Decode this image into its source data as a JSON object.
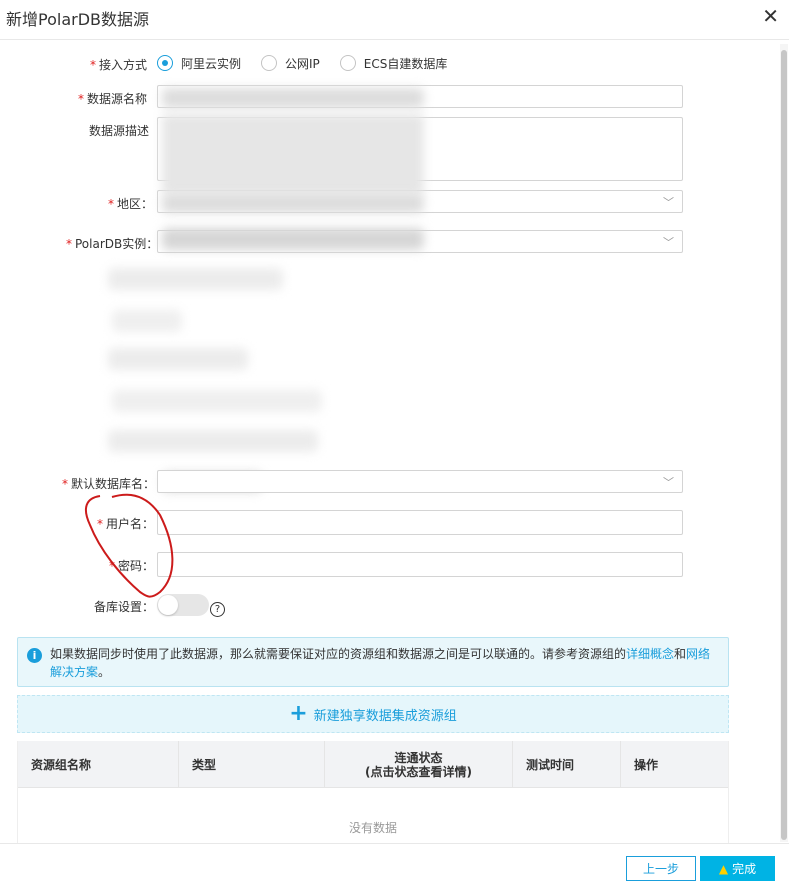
{
  "dialog": {
    "title": "新增PolarDB数据源",
    "close_icon": "close-icon"
  },
  "form": {
    "access_mode": {
      "label": "接入方式",
      "options": [
        "阿里云实例",
        "公网IP",
        "ECS自建数据库"
      ],
      "selected": "阿里云实例"
    },
    "datasource_name": {
      "label": "数据源名称"
    },
    "datasource_desc": {
      "label": "数据源描述"
    },
    "region": {
      "label": "地区"
    },
    "polardb_instance": {
      "label": "PolarDB实例"
    },
    "default_db": {
      "label": "默认数据库名"
    },
    "username": {
      "label": "用户名"
    },
    "password": {
      "label": "密码"
    },
    "standby": {
      "label": "备库设置",
      "help_icon": "question-icon"
    }
  },
  "required_mark": "*",
  "colon": "：",
  "info": {
    "text": "如果数据同步时使用了此数据源，那么就需要保证对应的资源组和数据源之间是可以联通的。请参考资源组的",
    "link1": "详细概念",
    "and": "和",
    "link2": "网络解决方案",
    "end": "。"
  },
  "new_group": {
    "label": "新建独享数据集成资源组"
  },
  "table": {
    "headers": [
      "资源组名称",
      "类型",
      "连通状态",
      "(点击状态查看详情)",
      "测试时间",
      "操作"
    ],
    "empty_text": "没有数据"
  },
  "footer": {
    "prev_label": "上一步",
    "done_label": "完成"
  },
  "colors": {
    "accent": "#1a9edb",
    "required": "#e02020",
    "annotation": "#cc1b1b"
  }
}
